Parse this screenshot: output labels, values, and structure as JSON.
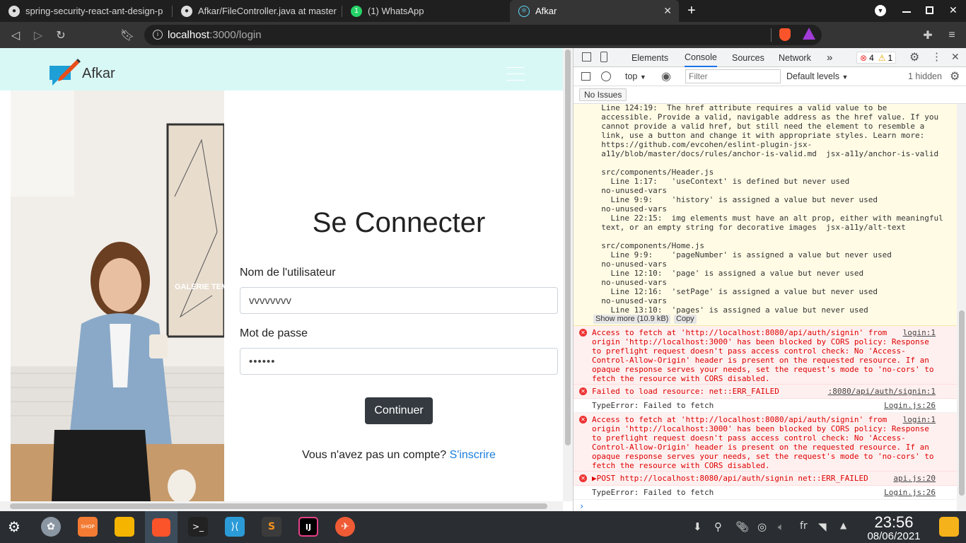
{
  "browser": {
    "tabs": [
      {
        "label": "spring-security-react-ant-design-p",
        "icon": "github-icon"
      },
      {
        "label": "Afkar/FileController.java at master",
        "icon": "github-icon"
      },
      {
        "label": "(1) WhatsApp",
        "icon": "whatsapp-icon",
        "badge": "1"
      },
      {
        "label": "Afkar",
        "icon": "react-icon",
        "active": true
      }
    ],
    "new_tab": "+",
    "url_host": "localhost",
    "url_path": ":3000/login"
  },
  "app": {
    "brand": "Afkar",
    "login_title": "Se Connecter",
    "username_label": "Nom de l'utilisateur",
    "username_value": "vvvvvvvv",
    "password_label": "Mot de passe",
    "password_value": "••••••",
    "continue_button": "Continuer",
    "signup_prompt": "Vous n'avez pas un compte?",
    "signup_link": "S'inscrire",
    "photo_poster_text": "GALERIE TEMPO"
  },
  "devtools": {
    "tabs": [
      "Elements",
      "Console",
      "Sources",
      "Network"
    ],
    "active_tab": "Console",
    "more_tabs": "»",
    "error_count": "4",
    "warning_count": "1",
    "context": "top",
    "filter_placeholder": "Filter",
    "levels": "Default levels",
    "hidden": "1 hidden",
    "issues": "No Issues",
    "warning_text": "  Line 124:19:  The href attribute requires a valid value to be\n  accessible. Provide a valid, navigable address as the href value. If you\n  cannot provide a valid href, but still need the element to resemble a\n  link, use a button and change it with appropriate styles. Learn more:\n  https://github.com/evcohen/eslint-plugin-jsx-\n  a11y/blob/master/docs/rules/anchor-is-valid.md  jsx-a11y/anchor-is-valid\n\n  src/components/Header.js\n    Line 1:17:   'useContext' is defined but never used\n  no-unused-vars\n    Line 9:9:    'history' is assigned a value but never used\n  no-unused-vars\n    Line 22:15:  img elements must have an alt prop, either with meaningful\n  text, or an empty string for decorative images  jsx-a11y/alt-text\n\n  src/components/Home.js\n    Line 9:9:    'pageNumber' is assigned a value but never used\n  no-unused-vars\n    Line 12:10:  'page' is assigned a value but never used\n  no-unused-vars\n    Line 12:16:  'setPage' is assigned a value but never used\n  no-unused-vars\n    Line 13:10:  'pages' is assigned a value but never used",
    "show_more": "Show more (10.9 kB)",
    "copy": "Copy",
    "cors_error_1": "Access to fetch at 'http://localhost:8080/api/auth/signin' from\norigin 'http://localhost:3000' has been blocked by CORS policy: Response\nto preflight request doesn't pass access control check: No 'Access-\nControl-Allow-Origin' header is present on the requested resource. If an\nopaque response serves your needs, set the request's mode to 'no-cors' to\nfetch the resource with CORS disabled.",
    "cors_src_1": "login:1",
    "failed_load": "Failed to load resource: net::ERR_FAILED",
    "failed_load_src": ":8080/api/auth/signin:1",
    "typeerror_1": "TypeError: Failed to fetch",
    "typeerror_src_1": "Login.js:26",
    "cors_error_2": "Access to fetch at 'http://localhost:8080/api/auth/signin' from\norigin 'http://localhost:3000' has been blocked by CORS policy: Response\nto preflight request doesn't pass access control check: No 'Access-\nControl-Allow-Origin' header is present on the requested resource. If an\nopaque response serves your needs, set the request's mode to 'no-cors' to\nfetch the resource with CORS disabled.",
    "cors_src_2": "login:1",
    "post_error": "▶POST http://localhost:8080/api/auth/signin net::ERR_FAILED",
    "post_src": "api.js:20",
    "typeerror_2": "TypeError: Failed to fetch",
    "typeerror_src_2": "Login.js:26",
    "prompt": "›"
  },
  "taskbar": {
    "lang": "fr",
    "time": "23:56",
    "date": "08/06/2021",
    "store_label": "SHOP",
    "ij_label": "IJ"
  },
  "colors": {
    "navbar_bg": "#d8f8f6",
    "continue_bg": "#343a40",
    "link": "#1a7ddb",
    "error_bg": "#fff0f0",
    "warn_bg": "#fffbe5"
  }
}
